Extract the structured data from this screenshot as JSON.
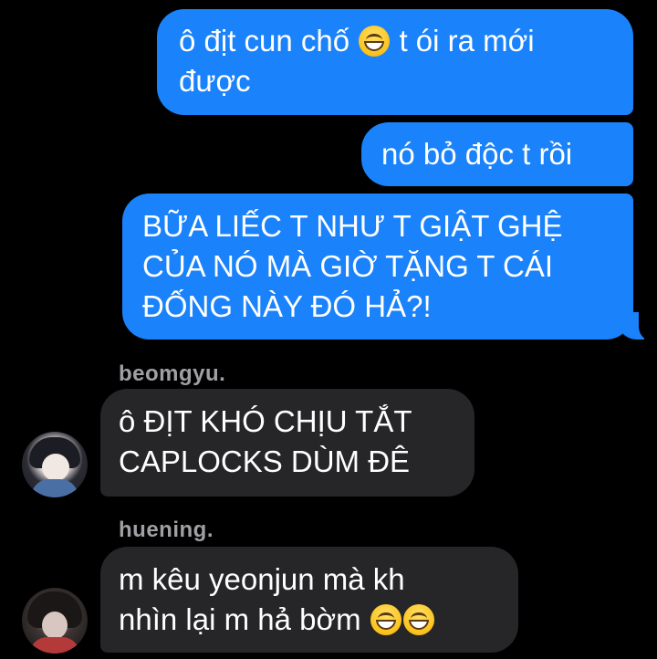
{
  "conversation": {
    "outgoing": [
      {
        "line1_before": "ô địt cun chố ",
        "line1_after": " t ói ra mới",
        "line2": "được",
        "emoji": "grinning-face-icon"
      },
      {
        "text": "nó bỏ độc t rồi"
      },
      {
        "line1": "BỮA LIẾC T NHƯ T GIẬT GHỆ",
        "line2": "CỦA NÓ MÀ GIỜ TẶNG T CÁI",
        "line3": "ĐỐNG NÀY ĐÓ HẢ?!"
      }
    ],
    "incoming": [
      {
        "sender": "beomgyu.",
        "line1": "ô ĐỊT KHÓ CHỊU TẮT",
        "line2": "CAPLOCKS DÙM ĐÊ"
      },
      {
        "sender": "huening.",
        "line1": "m kêu yeonjun mà kh",
        "line2": "nhìn lại m hả bờm ",
        "emoji": "grinning-face-icon"
      }
    ]
  },
  "colors": {
    "background": "#000000",
    "outgoing_bubble": "#1a82fb",
    "incoming_bubble": "#262628",
    "sender_name": "#a0a0a4",
    "text": "#ffffff"
  }
}
